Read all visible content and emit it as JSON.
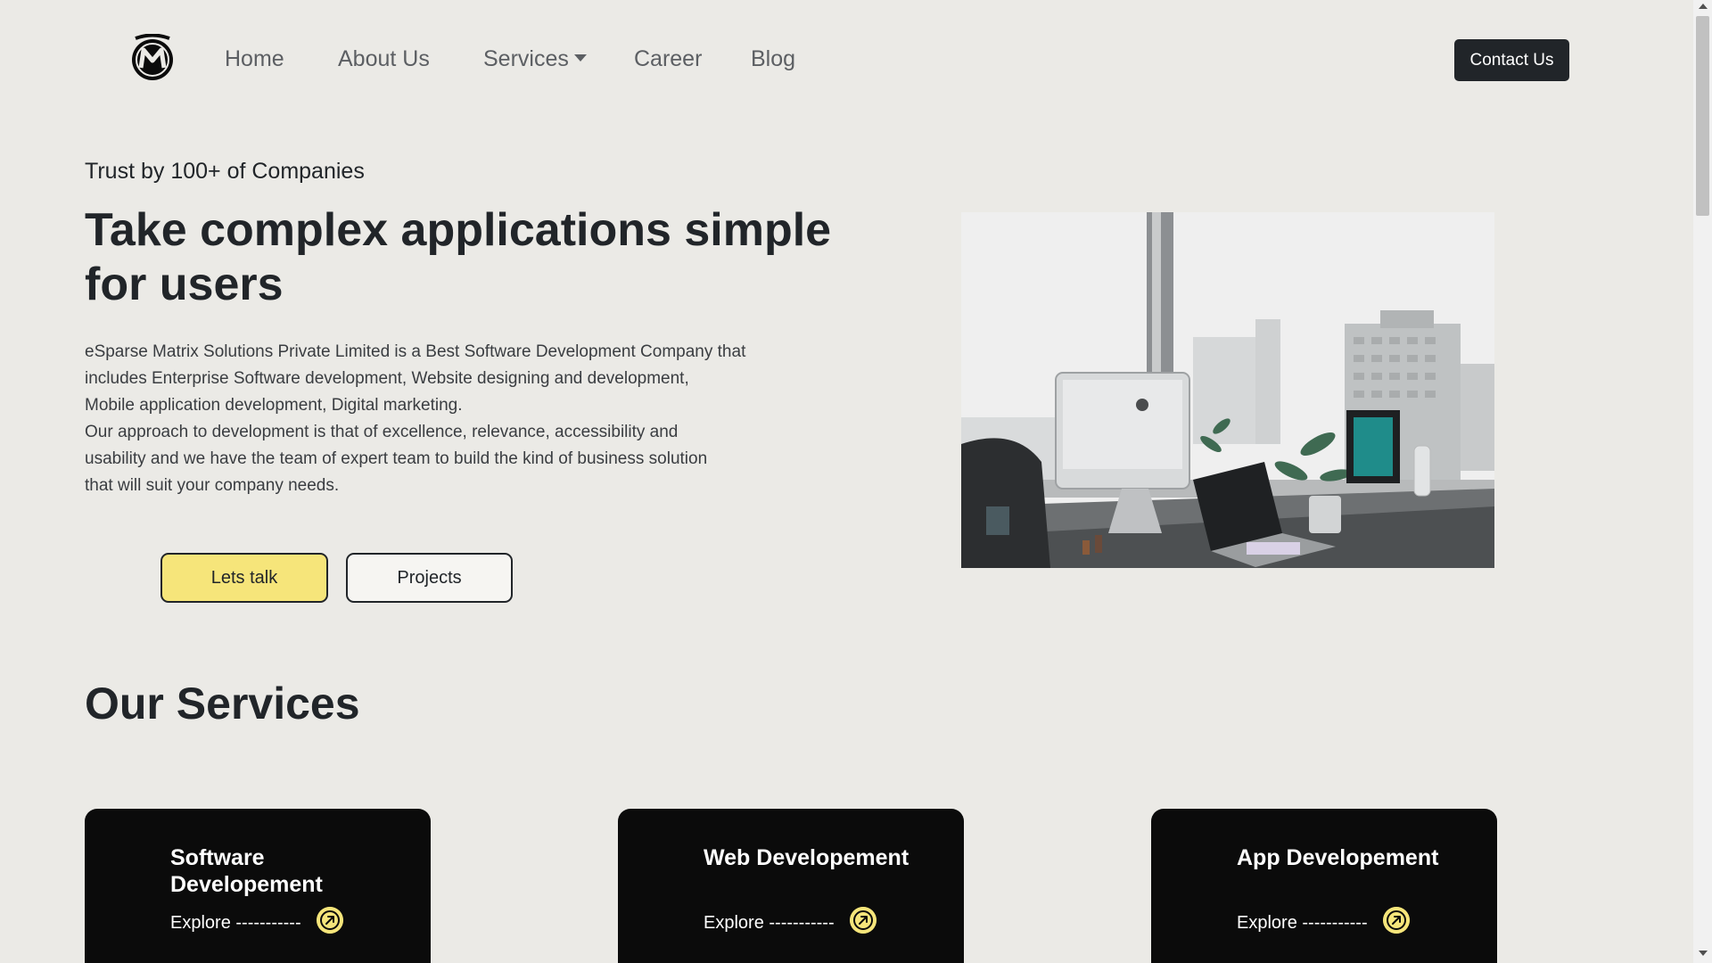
{
  "nav": {
    "items": [
      {
        "label": "Home"
      },
      {
        "label": "About Us"
      },
      {
        "label": "Services"
      },
      {
        "label": "Career"
      },
      {
        "label": "Blog"
      }
    ],
    "contact_label": "Contact Us"
  },
  "hero": {
    "trust": "Trust by 100+ of Companies",
    "title": "Take complex applications simple for users",
    "description_lines": [
      "eSparse Matrix Solutions Private Limited is a Best Software Development Company that",
      "includes Enterprise Software development, Website designing and development,",
      "Mobile application development, Digital marketing.",
      "Our approach to development is that of excellence, relevance, accessibility and",
      "usability and we have the team of expert team to build the kind of business solution",
      "that will suit your company needs."
    ],
    "primary_button": "Lets talk",
    "secondary_button": "Projects"
  },
  "services": {
    "title": "Our Services",
    "cards": [
      {
        "title": "Software Developement",
        "explore": "Explore -----------"
      },
      {
        "title": "Web Developement",
        "explore": "Explore -----------"
      },
      {
        "title": "App Developement",
        "explore": "Explore -----------"
      }
    ]
  },
  "colors": {
    "background": "#ebeae6",
    "accent_yellow": "#f6e57a",
    "dark": "#212529",
    "card_bg": "#0b0b0b"
  }
}
